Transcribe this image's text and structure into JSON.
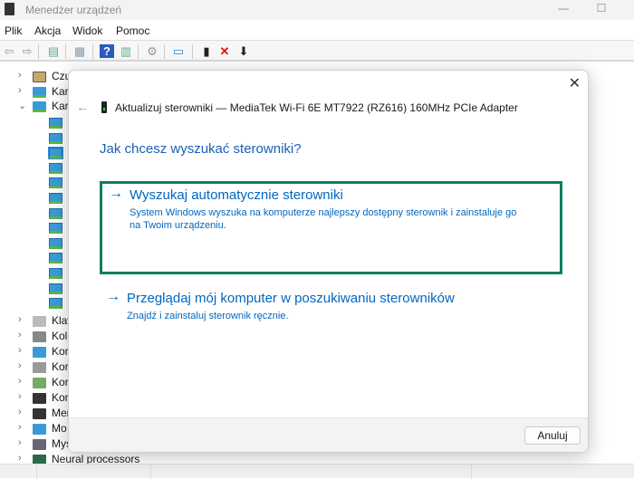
{
  "window": {
    "title": "Menedżer urządzeń"
  },
  "menu": [
    "Plik",
    "Akcja",
    "Widok",
    "Pomoc"
  ],
  "toolbar": {
    "icons": [
      "back-arrow-icon",
      "forward-arrow-icon",
      "show-hide-console-tree-icon",
      "properties-icon",
      "help-icon",
      "action-pane-icon",
      "update-driver-icon",
      "scan-hardware-icon",
      "enable-device-icon",
      "uninstall-device-icon",
      "disable-device-icon"
    ],
    "delete_color": "#e01010"
  },
  "tree": {
    "top": [
      {
        "label": "Czu",
        "expanded": false
      },
      {
        "label": "Kar",
        "expanded": false
      },
      {
        "label": "Kar",
        "expanded": true
      }
    ],
    "children_count": 13,
    "bottom": [
      {
        "label": "Klaw"
      },
      {
        "label": "Kol"
      },
      {
        "label": "Kor"
      },
      {
        "label": "Kor"
      },
      {
        "label": "Kor"
      },
      {
        "label": "Kor"
      },
      {
        "label": "Mer"
      },
      {
        "label": "Mo"
      },
      {
        "label": "Mys"
      },
      {
        "label": "Neural processors"
      }
    ]
  },
  "dialog": {
    "header": "Aktualizuj sterowniki — MediaTek Wi-Fi 6E MT7922 (RZ616) 160MHz PCIe Adapter",
    "question": "Jak chcesz wyszukać sterowniki?",
    "options": [
      {
        "title": "Wyszukaj automatycznie sterowniki",
        "desc": "System Windows wyszuka na komputerze najlepszy dostępny sterownik i zainstaluje go na Twoim urządzeniu."
      },
      {
        "title": "Przeglądaj mój komputer w poszukiwaniu sterowników",
        "desc": "Znajdź i zainstaluj sterownik ręcznie."
      }
    ],
    "cancel": "Anuluj",
    "accent": "#0067c0",
    "focus_color": "#0e7e62"
  }
}
